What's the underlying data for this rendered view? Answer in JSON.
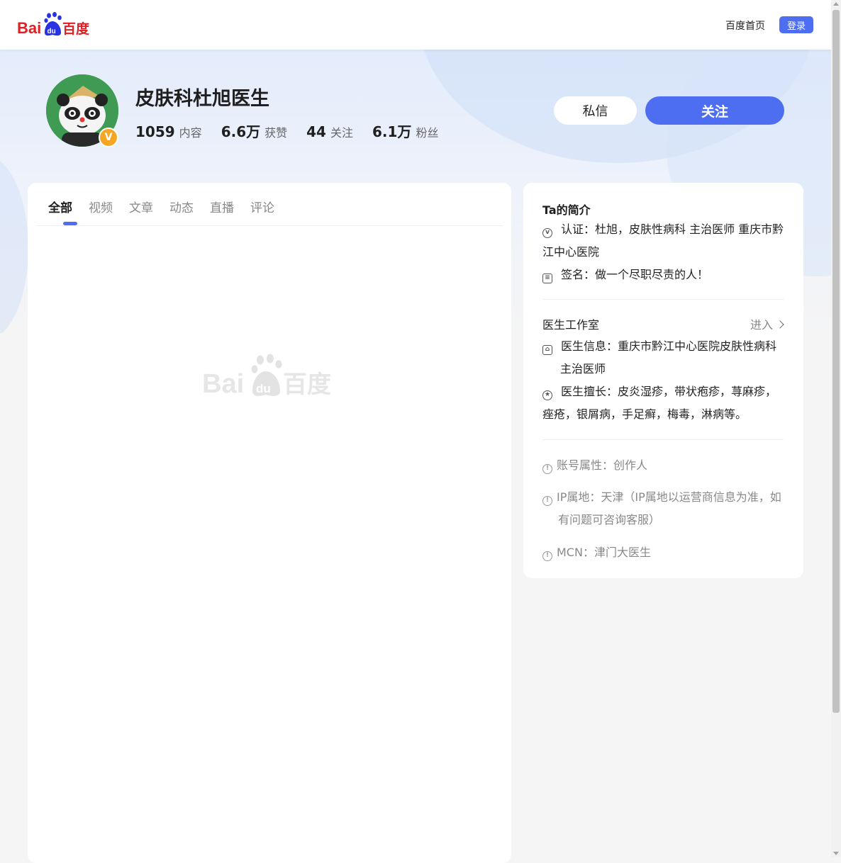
{
  "header": {
    "logo_alt": "Baidu百度",
    "home_link": "百度首页",
    "login_label": "登录"
  },
  "profile": {
    "name": "皮肤科杜旭医生",
    "badge": "V",
    "stats": [
      {
        "num": "1059",
        "label": "内容"
      },
      {
        "num": "6.6万",
        "label": "获赞"
      },
      {
        "num": "44",
        "label": "关注"
      },
      {
        "num": "6.1万",
        "label": "粉丝"
      }
    ],
    "message_label": "私信",
    "follow_label": "关注"
  },
  "tabs": [
    {
      "label": "全部",
      "active": true
    },
    {
      "label": "视频",
      "active": false
    },
    {
      "label": "文章",
      "active": false
    },
    {
      "label": "动态",
      "active": false
    },
    {
      "label": "直播",
      "active": false
    },
    {
      "label": "评论",
      "active": false
    }
  ],
  "about": {
    "title": "Ta的简介",
    "certification": "认证：杜旭，皮肤性病科 主治医师 重庆市黔江中心医院",
    "signature": "签名：做一个尽职尽责的人！",
    "studio_title": "医生工作室",
    "studio_enter": "进入",
    "doctor_info": "医生信息：重庆市黔江中心医院皮肤性病科主治医师",
    "specialty": "医生擅长：皮炎湿疹，带状疱疹，荨麻疹，痤疮，银屑病，手足癣，梅毒，淋病等。",
    "account_type": "账号属性：创作人",
    "ip_location": "IP属地：天津（IP属地以运营商信息为准，如有问题可咨询客服）",
    "mcn": "MCN：津门大医生"
  },
  "colors": {
    "accent": "#4e6ef2",
    "baidu_red": "#de1f26",
    "baidu_blue": "#2932e1",
    "badge": "#f5a623"
  }
}
